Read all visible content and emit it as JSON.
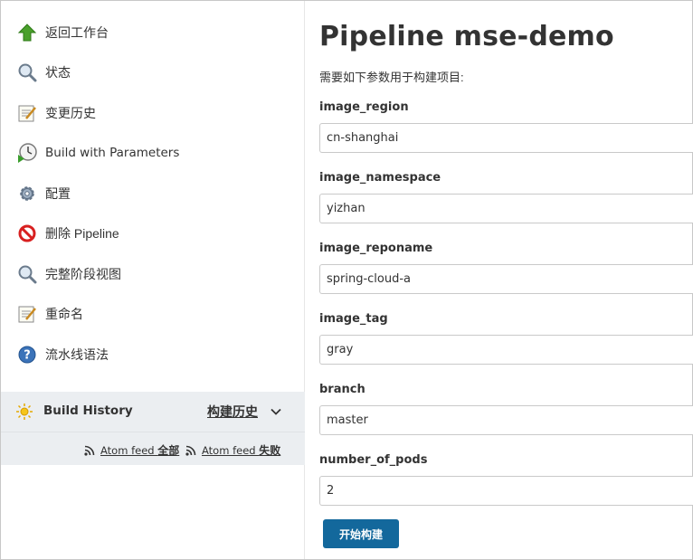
{
  "sidebar": {
    "tasks": [
      {
        "label": "返回工作台",
        "icon": "up-arrow-icon"
      },
      {
        "label": "状态",
        "icon": "magnifier-icon"
      },
      {
        "label": "变更历史",
        "icon": "notepad-icon"
      },
      {
        "label": "Build with Parameters",
        "icon": "clock-play-icon"
      },
      {
        "label": "配置",
        "icon": "gear-icon"
      },
      {
        "label": "删除 Pipeline",
        "icon": "no-entry-icon"
      },
      {
        "label": "完整阶段视图",
        "icon": "magnifier-icon"
      },
      {
        "label": "重命名",
        "icon": "notepad-icon"
      },
      {
        "label": "流水线语法",
        "icon": "help-icon"
      }
    ],
    "build_history": {
      "title": "Build History",
      "trend_link": "构建历史",
      "feeds": {
        "all_prefix": "Atom feed ",
        "all_suffix": "全部",
        "failed_prefix": "Atom feed ",
        "failed_suffix": "失败"
      }
    }
  },
  "main": {
    "title": "Pipeline mse-demo",
    "description": "需要如下参数用于构建项目:",
    "params": [
      {
        "name": "image_region",
        "value": "cn-shanghai"
      },
      {
        "name": "image_namespace",
        "value": "yizhan"
      },
      {
        "name": "image_reponame",
        "value": "spring-cloud-a"
      },
      {
        "name": "image_tag",
        "value": "gray"
      },
      {
        "name": "branch",
        "value": "master"
      },
      {
        "name": "number_of_pods",
        "value": "2"
      }
    ],
    "submit_label": "开始构建"
  },
  "colors": {
    "accent": "#13689c",
    "sidebar_panel": "#ebeef1"
  }
}
